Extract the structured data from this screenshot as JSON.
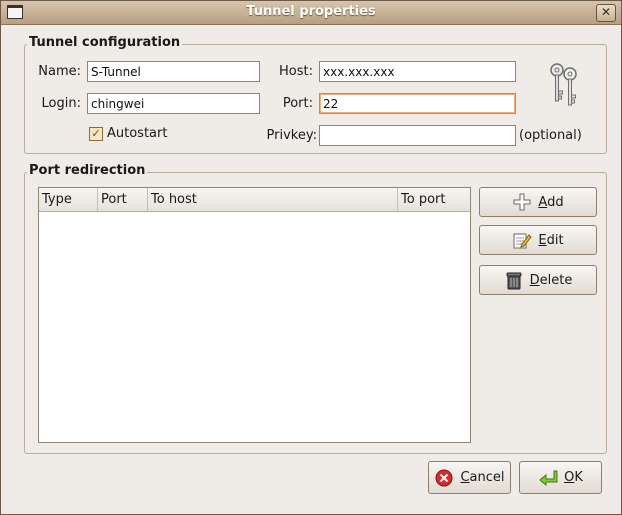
{
  "window": {
    "title": "Tunnel properties"
  },
  "tunnel_config": {
    "section_label": "Tunnel configuration",
    "name_label": "Name:",
    "name_value": "S-Tunnel",
    "login_label": "Login:",
    "login_value": "chingwei",
    "host_label": "Host:",
    "host_value": "xxx.xxx.xxx",
    "port_label": "Port:",
    "port_value": "22",
    "privkey_label": "Privkey:",
    "privkey_value": "",
    "privkey_hint": "(optional)",
    "autostart_label": "Autostart",
    "autostart_checked": true
  },
  "port_redirection": {
    "section_label": "Port redirection",
    "columns": [
      "Type",
      "Port",
      "To host",
      "To port"
    ],
    "rows": [],
    "add_label": "Add",
    "edit_label": "Edit",
    "delete_label": "Delete"
  },
  "dialog_buttons": {
    "cancel_label": "Cancel",
    "ok_label": "OK"
  },
  "colors": {
    "title_bar": "#c6b08f",
    "focus_border": "#e0833a",
    "window_bg": "#efebe7"
  }
}
